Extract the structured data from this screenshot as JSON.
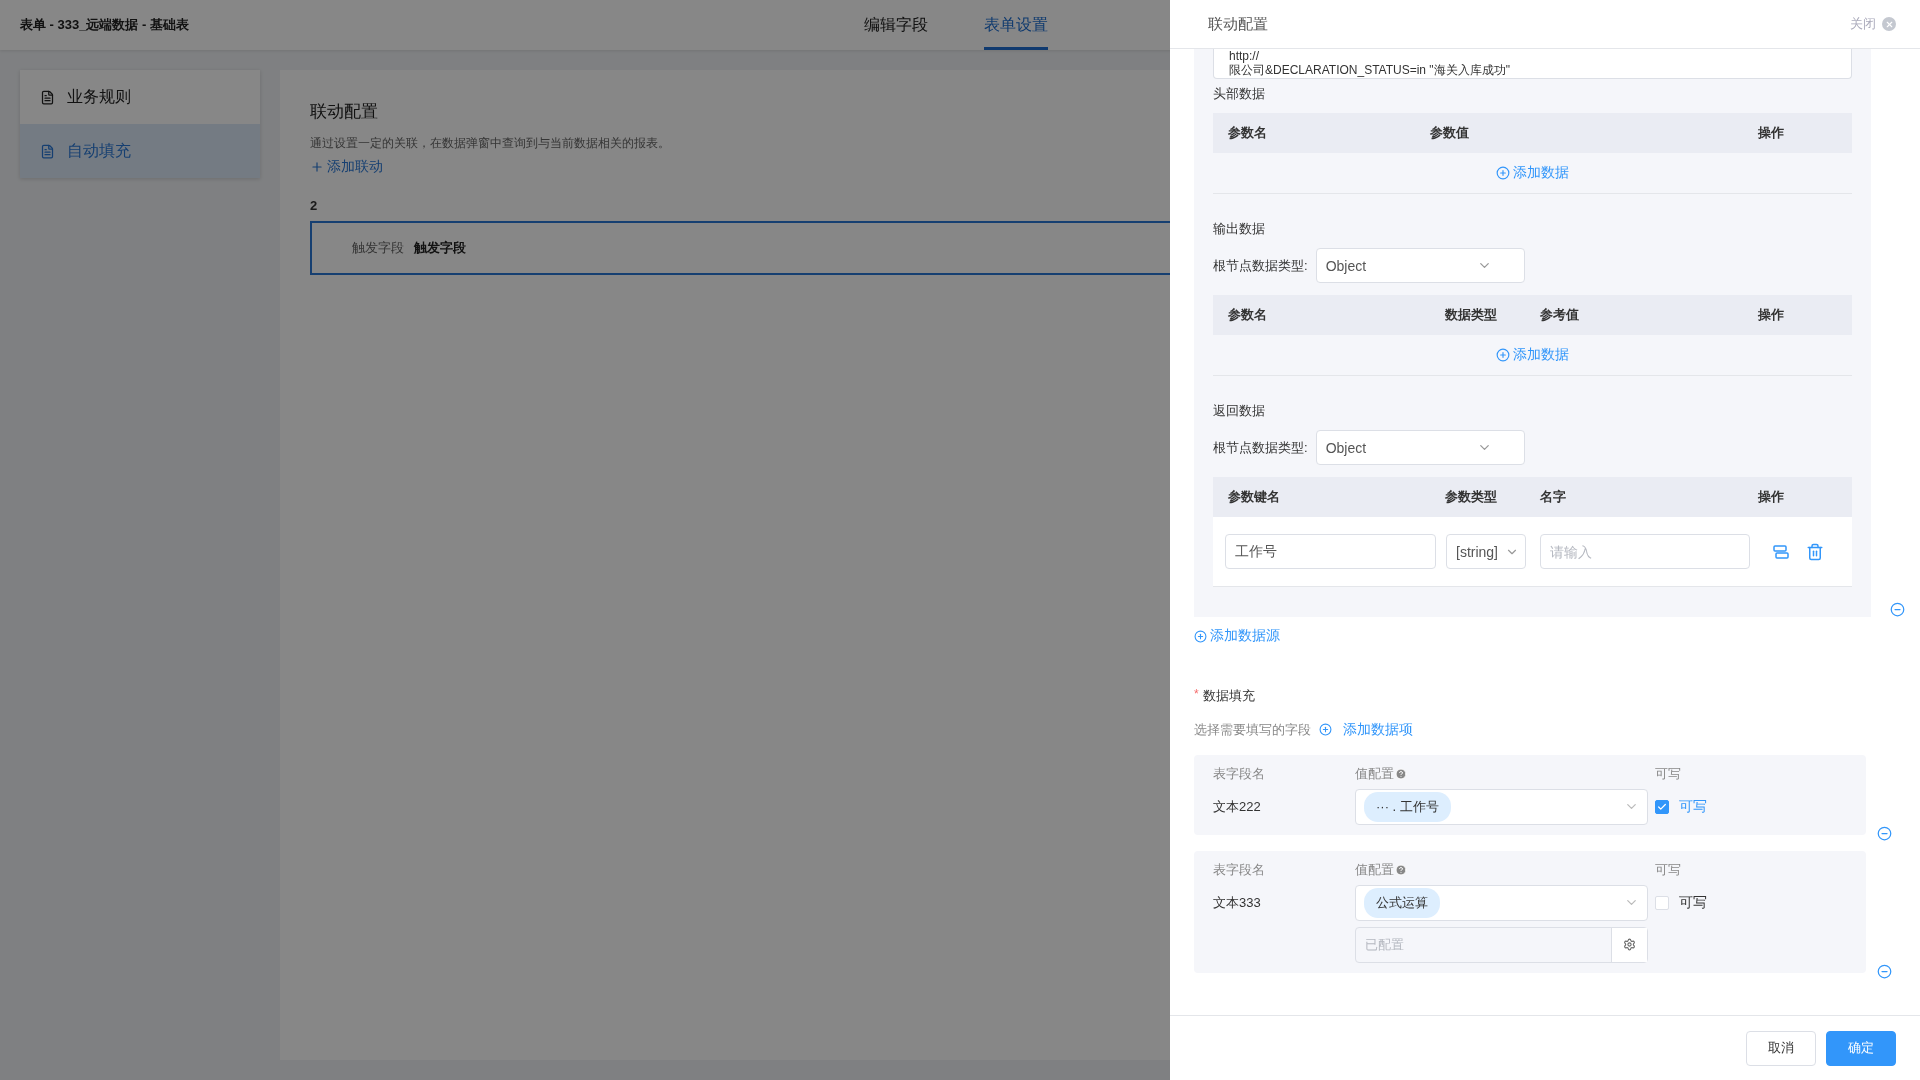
{
  "page": {
    "title": "表单 - 333_远端数据 - 基础表",
    "tabs": [
      {
        "label": "编辑字段",
        "selected": false
      },
      {
        "label": "表单设置",
        "selected": true
      }
    ],
    "sidebar": [
      {
        "label": "业务规则",
        "selected": false
      },
      {
        "label": "自动填充",
        "selected": true
      }
    ],
    "card": {
      "title": "联动配置",
      "description": "通过设置一定的关联，在数据弹窗中查询到与当前数据相关的报表。",
      "add_link": "添加联动",
      "group_number": "2",
      "trigger": {
        "label": "触发字段",
        "value": "触发字段"
      }
    }
  },
  "drawer": {
    "title": "联动配置",
    "close": "关闭",
    "url_lines": [
      "http://",
      "限公司&DECLARATION_STATUS=in \"海关入库成功\""
    ],
    "header_data": {
      "label": "头部数据",
      "columns": [
        "参数名",
        "参数值",
        "操作"
      ],
      "add": "添加数据"
    },
    "output_data": {
      "label": "输出数据",
      "root_type_label": "根节点数据类型:",
      "root_type_value": "Object",
      "columns": [
        "参数名",
        "数据类型",
        "参考值",
        "操作"
      ],
      "add": "添加数据"
    },
    "return_data": {
      "label": "返回数据",
      "root_type_label": "根节点数据类型:",
      "root_type_value": "Object",
      "columns": [
        "参数键名",
        "参数类型",
        "名字",
        "操作"
      ],
      "rows": [
        {
          "key": "工作号",
          "type": "[string]",
          "name_placeholder": "请输入"
        }
      ]
    },
    "add_source": "添加数据源",
    "fill": {
      "label": "数据填充",
      "required_mark": "*",
      "hint": "选择需要填写的字段",
      "add": "添加数据项",
      "items": [
        {
          "field_label": "表字段名",
          "value_label": "值配置",
          "writable_label": "可写",
          "name": "文本222",
          "tag": "··· . 工作号",
          "writable": true,
          "writable_text": "可写"
        },
        {
          "field_label": "表字段名",
          "value_label": "值配置",
          "writable_label": "可写",
          "name": "文本333",
          "tag": "公式运算",
          "writable": false,
          "writable_text": "可写",
          "extra_placeholder": "已配置"
        }
      ]
    },
    "buttons": [
      {
        "label": "取消",
        "kind": "default"
      },
      {
        "label": "确定",
        "kind": "primary"
      }
    ]
  }
}
